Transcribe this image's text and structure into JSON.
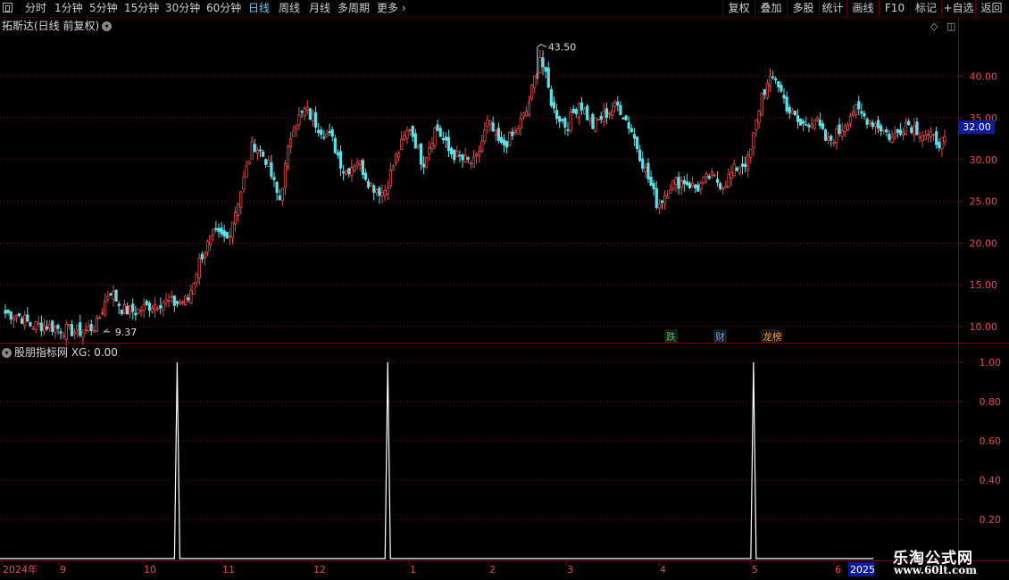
{
  "toolbar": {
    "periods": [
      "分时",
      "1分钟",
      "5分钟",
      "15分钟",
      "30分钟",
      "60分钟",
      "日线",
      "周线",
      "月线",
      "多周期",
      "更多"
    ],
    "active_period": "日线",
    "right_buttons": [
      "复权",
      "叠加",
      "多股",
      "统计",
      "画线",
      "F10",
      "标记",
      "+自选",
      "返回"
    ]
  },
  "chart_title": "拓斯达(日线 前复权)",
  "indicator_title": "股朋指标网 XG: 0.00",
  "current_price_tag": "32.00",
  "markers": [
    {
      "label": "跌",
      "color": "#3ad03a"
    },
    {
      "label": "财",
      "color": "#6aa8ff"
    },
    {
      "label": "龙榜",
      "color": "#ff9a3a"
    }
  ],
  "watermark": {
    "cn": "乐淘公式网",
    "url": "www.60lt.com"
  },
  "colors": {
    "up": "#e84848",
    "down": "#5fe0e8",
    "axis": "#8b0000",
    "grid": "#5a0a0a",
    "label": "#e84848"
  },
  "chart_data": [
    {
      "type": "candlestick",
      "price_axis": {
        "min": 8.5,
        "max": 45.5,
        "ticks": [
          10.0,
          15.0,
          20.0,
          25.0,
          30.0,
          35.0,
          40.0
        ],
        "tick_labels": [
          "10.00",
          "15.00",
          "20.00",
          "25.00",
          "30.00",
          "35.00",
          "40.00"
        ]
      },
      "annotations": {
        "high": {
          "value": 43.5,
          "label": "43.50"
        },
        "low": {
          "value": 9.37,
          "label": "9.37"
        }
      },
      "time_axis_labels": [
        "2024年",
        "9",
        "10",
        "11",
        "12",
        "1",
        "2",
        "3",
        "4",
        "5",
        "6",
        "2025"
      ],
      "close_path": [
        11.6,
        11.4,
        10.1,
        10.2,
        9.8,
        9.5,
        9.4,
        10.2,
        14.5,
        12.0,
        11.8,
        12.5,
        13.0,
        12.8,
        13.2,
        18.5,
        21.0,
        20.5,
        26.0,
        32.0,
        30.0,
        25.0,
        34.0,
        36.0,
        34.0,
        32.5,
        28.5,
        30.0,
        27.0,
        26.0,
        30.5,
        34.0,
        29.5,
        34.0,
        31.0,
        30.0,
        29.5,
        34.5,
        31.5,
        33.0,
        36.0,
        42.5,
        36.0,
        34.0,
        37.0,
        34.0,
        35.5,
        36.5,
        33.5,
        29.0,
        24.5,
        27.0,
        27.5,
        26.5,
        28.0,
        27.0,
        29.0,
        30.0,
        38.0,
        40.0,
        36.0,
        34.0,
        35.0,
        32.0,
        33.5,
        36.0,
        35.0,
        34.0,
        32.5,
        34.5,
        33.5,
        32.5,
        32.0
      ]
    },
    {
      "type": "line",
      "series": [
        {
          "name": "XG",
          "values": [
            0,
            0,
            0,
            0,
            0,
            0,
            0,
            0,
            0,
            0,
            0,
            0,
            0,
            0,
            0,
            1,
            0,
            0,
            0,
            0,
            0,
            0,
            0,
            0,
            0,
            0,
            0,
            0,
            0,
            0,
            0,
            0,
            0,
            0,
            0,
            0,
            0,
            0,
            1,
            0,
            0,
            0,
            0,
            0,
            0,
            0,
            0,
            0,
            0,
            0,
            0,
            0,
            0,
            0,
            0,
            0,
            0,
            0,
            0,
            0,
            0,
            0,
            0,
            0,
            0,
            0,
            0,
            0,
            0,
            0,
            0,
            0,
            1,
            0,
            0,
            0,
            0,
            0,
            0,
            0,
            0,
            0,
            0,
            0,
            0,
            0,
            0,
            0,
            0,
            0,
            0,
            0,
            0,
            0,
            0,
            0,
            0,
            0,
            0,
            0
          ]
        }
      ],
      "signal_days": [
        62,
        138,
        270
      ],
      "total_days": 340,
      "y_axis": {
        "min": 0,
        "max": 1.0,
        "ticks": [
          0.2,
          0.4,
          0.6,
          0.8,
          1.0
        ],
        "tick_labels": [
          "0.20",
          "0.40",
          "0.60",
          "0.80",
          "1.00"
        ]
      }
    }
  ]
}
